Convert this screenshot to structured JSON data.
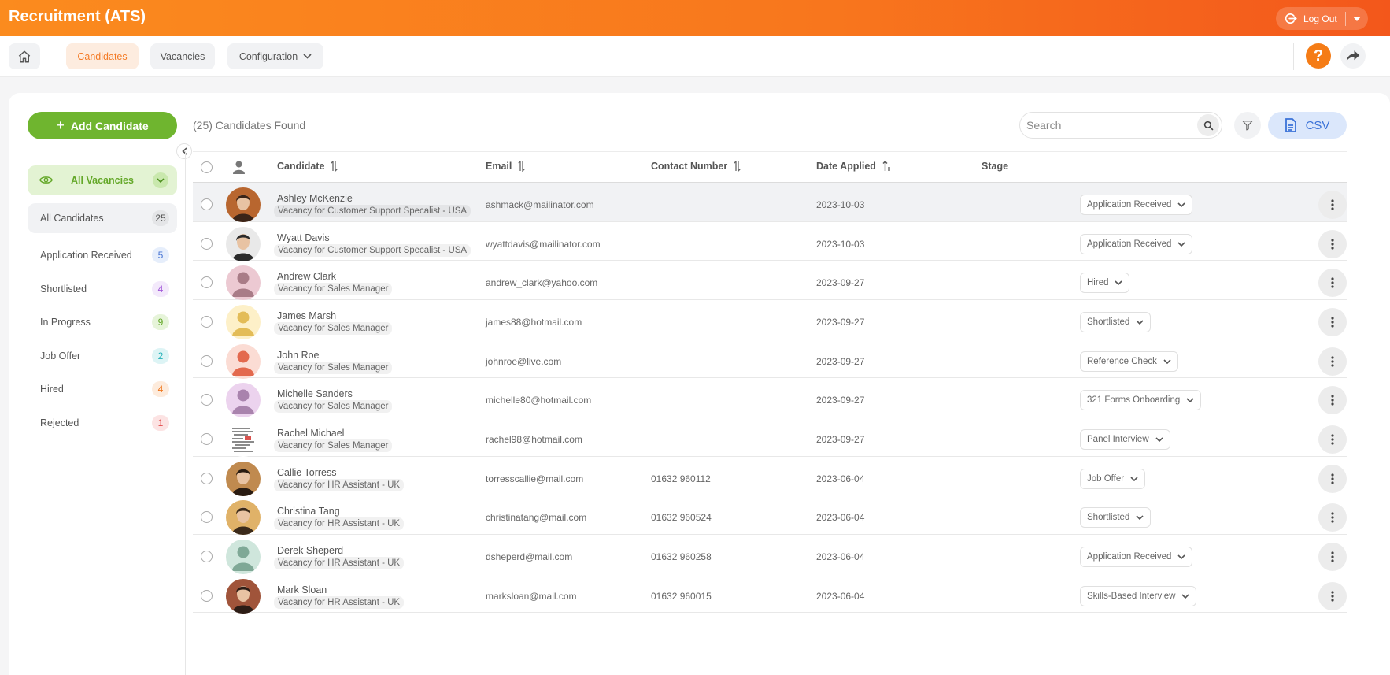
{
  "app": {
    "title": "Recruitment (ATS)",
    "logout_label": "Log Out"
  },
  "nav": {
    "tabs": [
      {
        "label": "Candidates",
        "active": true
      },
      {
        "label": "Vacancies",
        "active": false
      },
      {
        "label": "Configuration",
        "active": false
      }
    ],
    "help_label": "?"
  },
  "actions": {
    "add_candidate": "Add Candidate",
    "csv": "CSV"
  },
  "sidebar": {
    "vacancy_filter": "All Vacancies",
    "items": [
      {
        "label": "All Candidates",
        "count": "25",
        "color": "#555555",
        "bg": "#e4e5e7"
      },
      {
        "label": "Application Received",
        "count": "5",
        "color": "#4a76d4",
        "bg": "#e6eefb"
      },
      {
        "label": "Shortlisted",
        "count": "4",
        "color": "#a259d9",
        "bg": "#f3e9fb"
      },
      {
        "label": "In Progress",
        "count": "9",
        "color": "#64a829",
        "bg": "#e6f4d9"
      },
      {
        "label": "Job Offer",
        "count": "2",
        "color": "#23b0b8",
        "bg": "#ddf4f5"
      },
      {
        "label": "Hired",
        "count": "4",
        "color": "#f0771d",
        "bg": "#fdebdc"
      },
      {
        "label": "Rejected",
        "count": "1",
        "color": "#e34a4a",
        "bg": "#fce3e3"
      }
    ]
  },
  "summary": {
    "found": "(25) Candidates Found"
  },
  "search": {
    "placeholder": "Search"
  },
  "table": {
    "headers": {
      "candidate": "Candidate",
      "email": "Email",
      "contact": "Contact Number",
      "date": "Date Applied",
      "stage": "Stage"
    },
    "rows": [
      {
        "name": "Ashley McKenzie",
        "vacancy": "Vacancy for Customer Support Specalist - USA",
        "email": "ashmack@mailinator.com",
        "contact": "",
        "date": "2023-10-03",
        "stage": "Application Received",
        "avatar": "photo",
        "avatar_colors": [
          "#b8662f",
          "#3a2418"
        ]
      },
      {
        "name": "Wyatt Davis",
        "vacancy": "Vacancy for Customer Support Specalist - USA",
        "email": "wyattdavis@mailinator.com",
        "contact": "",
        "date": "2023-10-03",
        "stage": "Application Received",
        "avatar": "photo",
        "avatar_colors": [
          "#e9e9e9",
          "#2b2b2b"
        ]
      },
      {
        "name": "Andrew Clark",
        "vacancy": "Vacancy for Sales Manager",
        "email": "andrew_clark@yahoo.com",
        "contact": "",
        "date": "2023-09-27",
        "stage": "Hired",
        "avatar": "placeholder",
        "avatar_colors": [
          "#ecc9d2",
          "#a97c87"
        ]
      },
      {
        "name": "James Marsh",
        "vacancy": "Vacancy for Sales Manager",
        "email": "james88@hotmail.com",
        "contact": "",
        "date": "2023-09-27",
        "stage": "Shortlisted",
        "avatar": "placeholder",
        "avatar_colors": [
          "#fdf0c8",
          "#e3bc57"
        ]
      },
      {
        "name": "John Roe",
        "vacancy": "Vacancy for Sales Manager",
        "email": "johnroe@live.com",
        "contact": "",
        "date": "2023-09-27",
        "stage": "Reference Check",
        "avatar": "placeholder",
        "avatar_colors": [
          "#fbdcd4",
          "#e3694e"
        ]
      },
      {
        "name": "Michelle Sanders",
        "vacancy": "Vacancy for Sales Manager",
        "email": "michelle80@hotmail.com",
        "contact": "",
        "date": "2023-09-27",
        "stage": "321 Forms Onboarding",
        "avatar": "placeholder",
        "avatar_colors": [
          "#ecd3ee",
          "#a983ad"
        ]
      },
      {
        "name": "Rachel Michael",
        "vacancy": "Vacancy for Sales Manager",
        "email": "rachel98@hotmail.com",
        "contact": "",
        "date": "2023-09-27",
        "stage": "Panel Interview",
        "avatar": "document",
        "avatar_colors": [
          "#ffffff",
          "#444444"
        ]
      },
      {
        "name": "Callie Torress",
        "vacancy": "Vacancy for HR Assistant - UK",
        "email": "torresscallie@mail.com",
        "contact": "01632 960112",
        "date": "2023-06-04",
        "stage": "Job Offer",
        "avatar": "photo",
        "avatar_colors": [
          "#c08a4f",
          "#2a1c12"
        ]
      },
      {
        "name": "Christina Tang",
        "vacancy": "Vacancy for HR Assistant - UK",
        "email": "christinatang@mail.com",
        "contact": "01632 960524",
        "date": "2023-06-04",
        "stage": "Shortlisted",
        "avatar": "photo",
        "avatar_colors": [
          "#e0b268",
          "#3b2a1a"
        ]
      },
      {
        "name": "Derek Sheperd",
        "vacancy": "Vacancy for HR Assistant - UK",
        "email": "dsheperd@mail.com",
        "contact": "01632 960258",
        "date": "2023-06-04",
        "stage": "Application Received",
        "avatar": "placeholder",
        "avatar_colors": [
          "#cfe6dc",
          "#7fa896"
        ]
      },
      {
        "name": "Mark Sloan",
        "vacancy": "Vacancy for HR Assistant - UK",
        "email": "marksloan@mail.com",
        "contact": "01632 960015",
        "date": "2023-06-04",
        "stage": "Skills-Based Interview",
        "avatar": "photo",
        "avatar_colors": [
          "#a0543a",
          "#2d1d16"
        ]
      }
    ]
  },
  "colors": {
    "brand_orange": "#f8761d",
    "accent_green": "#6fb52f",
    "csv_blue": "#3a72d8"
  }
}
